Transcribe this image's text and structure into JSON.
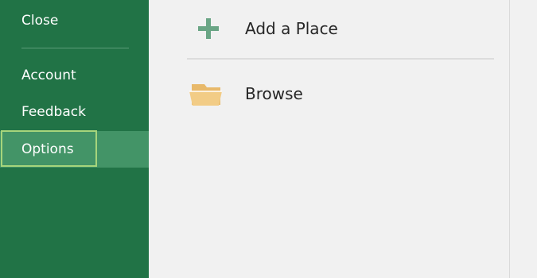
{
  "sidebar": {
    "close_label": "Close",
    "items": [
      {
        "label": "Account"
      },
      {
        "label": "Feedback"
      },
      {
        "label": "Options",
        "selected": true
      }
    ]
  },
  "places": [
    {
      "icon": "plus-icon",
      "label": "Add a Place"
    },
    {
      "icon": "folder-icon",
      "label": "Browse"
    }
  ],
  "colors": {
    "sidebar_green": "#217346",
    "selected_item": "#439467",
    "focus_ring": "#a6d57c",
    "plus_icon": "#6aa585",
    "folder_icon": "#f0c97e",
    "pane_background": "#f1f1f1"
  }
}
